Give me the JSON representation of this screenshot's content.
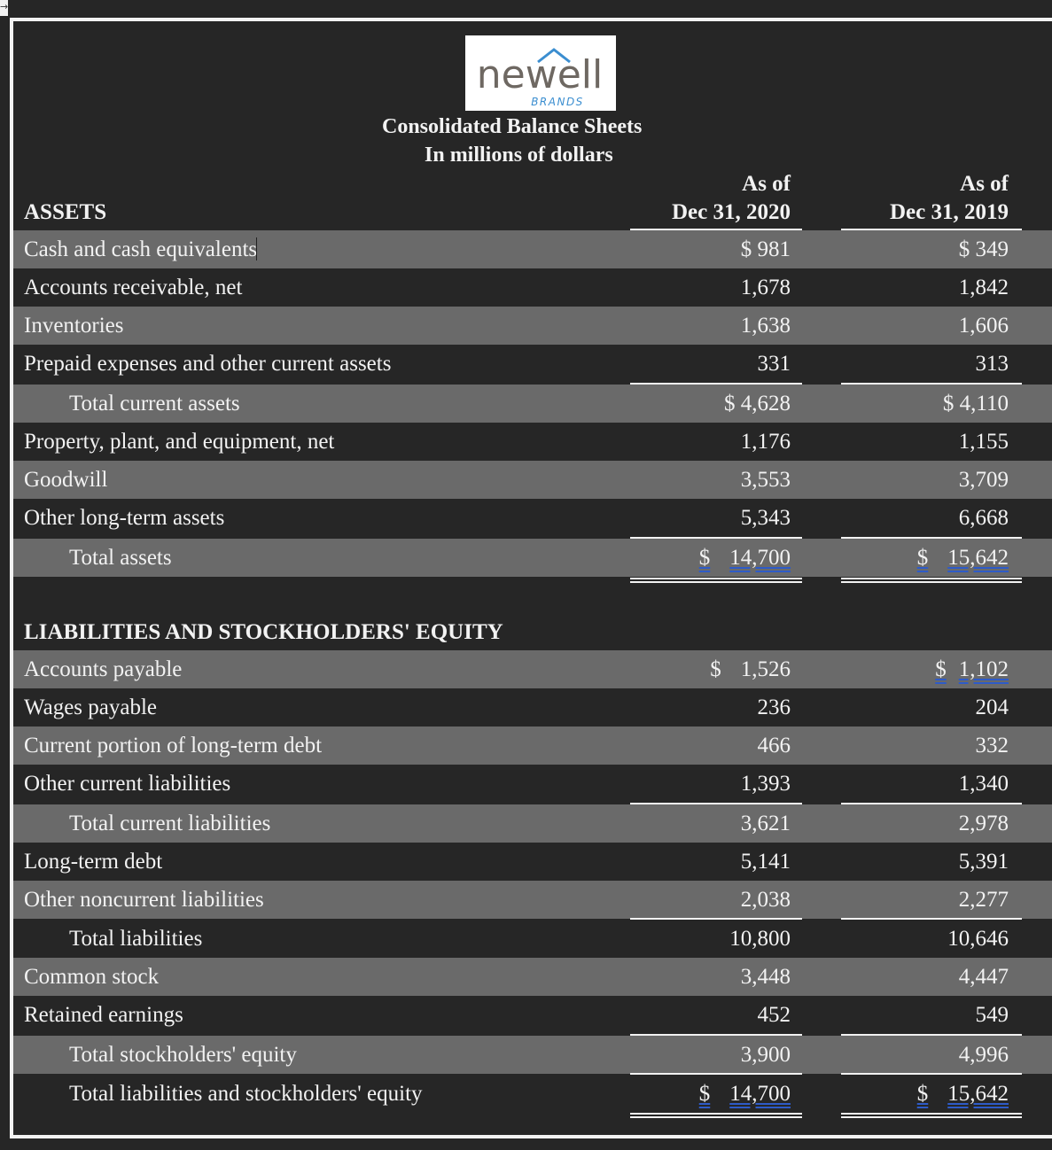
{
  "logo": {
    "wordmark": "newell",
    "sub": "BRANDS",
    "accent_color": "#3b8ed0",
    "text_color": "#6e6862"
  },
  "title": "Consolidated Balance Sheets",
  "subtitle": "In millions of dollars",
  "columns": [
    {
      "line1": "As of",
      "line2": "Dec 31, 2020"
    },
    {
      "line1": "As of",
      "line2": "Dec 31, 2019"
    }
  ],
  "assets": {
    "heading": "ASSETS",
    "rows": [
      {
        "label": "Cash and cash equivalents",
        "v1": "$ 981",
        "v2": "$ 349"
      },
      {
        "label": "Accounts receivable, net",
        "v1": "1,678",
        "v2": "1,842"
      },
      {
        "label": "Inventories",
        "v1": "1,638",
        "v2": "1,606"
      },
      {
        "label": "Prepaid expenses and other current assets",
        "v1": "331",
        "v2": "313"
      },
      {
        "label": "Total current assets",
        "v1": "$ 4,628",
        "v2": "$ 4,110"
      },
      {
        "label": "Property, plant, and equipment, net",
        "v1": "1,176",
        "v2": "1,155"
      },
      {
        "label": "Goodwill",
        "v1": "3,553",
        "v2": "3,709"
      },
      {
        "label": "Other long-term assets",
        "v1": "5,343",
        "v2": "6,668"
      },
      {
        "label": "Total assets",
        "v1_sym": "$",
        "v1": "14,700",
        "v2_sym": "$",
        "v2": "15,642"
      }
    ]
  },
  "liabilities": {
    "heading": "LIABILITIES AND STOCKHOLDERS' EQUITY",
    "rows": [
      {
        "label": "Accounts payable",
        "v1_sym": "$",
        "v1": "1,526",
        "v2_sym": "$",
        "v2": "1,102"
      },
      {
        "label": "Wages payable",
        "v1": "236",
        "v2": "204"
      },
      {
        "label": "Current portion of long-term debt",
        "v1": "466",
        "v2": "332"
      },
      {
        "label": "Other current liabilities",
        "v1": "1,393",
        "v2": "1,340"
      },
      {
        "label": "Total current liabilities",
        "v1": "3,621",
        "v2": "2,978"
      },
      {
        "label": "Long-term debt",
        "v1": "5,141",
        "v2": "5,391"
      },
      {
        "label": "Other noncurrent liabilities",
        "v1": "2,038",
        "v2": "2,277"
      },
      {
        "label": "Total liabilities",
        "v1": "10,800",
        "v2": "10,646"
      },
      {
        "label": "Common stock",
        "v1": "3,448",
        "v2": "4,447"
      },
      {
        "label": "Retained earnings",
        "v1": "452",
        "v2": "549"
      },
      {
        "label": "Total stockholders' equity",
        "v1": "3,900",
        "v2": "4,996"
      },
      {
        "label": "Total liabilities and stockholders' equity",
        "v1_sym": "$",
        "v1": "14,700",
        "v2_sym": "$",
        "v2": "15,642"
      }
    ]
  }
}
